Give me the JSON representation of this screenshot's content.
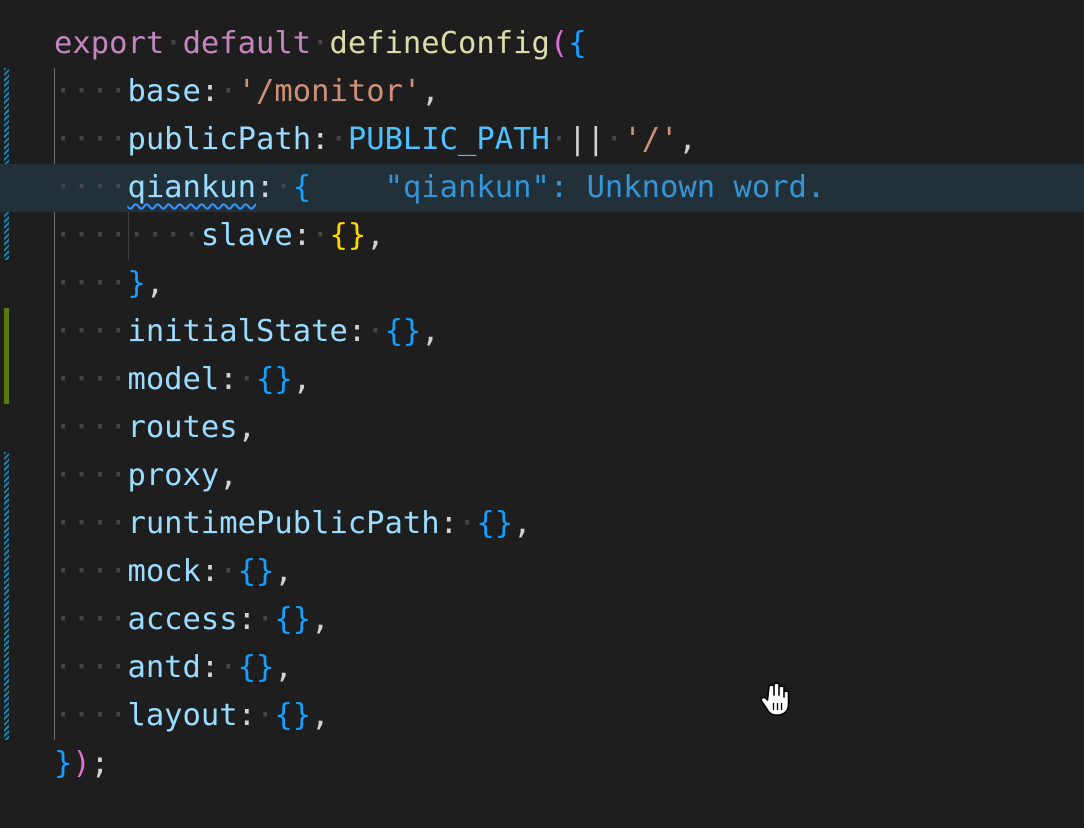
{
  "editor": {
    "lines": [
      {
        "tokens": [
          {
            "t": "export",
            "c": "kw"
          },
          {
            "t": "·",
            "c": "ws"
          },
          {
            "t": "default",
            "c": "kw"
          },
          {
            "t": "·",
            "c": "ws"
          },
          {
            "t": "defineConfig",
            "c": "fn"
          },
          {
            "t": "(",
            "c": "brace-pink"
          },
          {
            "t": "{",
            "c": "brace-blue"
          }
        ]
      },
      {
        "tokens": [
          {
            "t": "····",
            "c": "ws"
          },
          {
            "t": "base",
            "c": "prop"
          },
          {
            "t": ":",
            "c": "punct"
          },
          {
            "t": "·",
            "c": "ws"
          },
          {
            "t": "'/monitor'",
            "c": "str"
          },
          {
            "t": ",",
            "c": "punct"
          }
        ]
      },
      {
        "tokens": [
          {
            "t": "····",
            "c": "ws"
          },
          {
            "t": "publicPath",
            "c": "prop"
          },
          {
            "t": ":",
            "c": "punct"
          },
          {
            "t": "·",
            "c": "ws"
          },
          {
            "t": "PUBLIC_PATH",
            "c": "const"
          },
          {
            "t": "·",
            "c": "ws"
          },
          {
            "t": "||",
            "c": "punct"
          },
          {
            "t": "·",
            "c": "ws"
          },
          {
            "t": "'/'",
            "c": "str"
          },
          {
            "t": ",",
            "c": "punct"
          }
        ]
      },
      {
        "active": true,
        "tokens": [
          {
            "t": "····",
            "c": "ws"
          },
          {
            "t": "qiankun",
            "c": "prop squiggle"
          },
          {
            "t": ":",
            "c": "punct"
          },
          {
            "t": "·",
            "c": "ws"
          },
          {
            "t": "{",
            "c": "brace-blue"
          },
          {
            "t": "    ",
            "c": "punct"
          },
          {
            "t": "\"qiankun\": Unknown word.",
            "c": "hint"
          }
        ]
      },
      {
        "tokens": [
          {
            "t": "········",
            "c": "ws"
          },
          {
            "t": "slave",
            "c": "prop"
          },
          {
            "t": ":",
            "c": "punct"
          },
          {
            "t": "·",
            "c": "ws"
          },
          {
            "t": "{}",
            "c": "brace-yellow"
          },
          {
            "t": ",",
            "c": "punct"
          }
        ]
      },
      {
        "tokens": [
          {
            "t": "····",
            "c": "ws"
          },
          {
            "t": "}",
            "c": "brace-blue"
          },
          {
            "t": ",",
            "c": "punct"
          }
        ]
      },
      {
        "tokens": [
          {
            "t": "····",
            "c": "ws"
          },
          {
            "t": "initialState",
            "c": "prop"
          },
          {
            "t": ":",
            "c": "punct"
          },
          {
            "t": "·",
            "c": "ws"
          },
          {
            "t": "{}",
            "c": "brace-blue"
          },
          {
            "t": ",",
            "c": "punct"
          }
        ]
      },
      {
        "tokens": [
          {
            "t": "····",
            "c": "ws"
          },
          {
            "t": "model",
            "c": "prop"
          },
          {
            "t": ":",
            "c": "punct"
          },
          {
            "t": "·",
            "c": "ws"
          },
          {
            "t": "{}",
            "c": "brace-blue"
          },
          {
            "t": ",",
            "c": "punct"
          }
        ]
      },
      {
        "tokens": [
          {
            "t": "····",
            "c": "ws"
          },
          {
            "t": "routes",
            "c": "prop"
          },
          {
            "t": ",",
            "c": "punct"
          }
        ]
      },
      {
        "tokens": [
          {
            "t": "····",
            "c": "ws"
          },
          {
            "t": "proxy",
            "c": "prop"
          },
          {
            "t": ",",
            "c": "punct"
          }
        ]
      },
      {
        "tokens": [
          {
            "t": "····",
            "c": "ws"
          },
          {
            "t": "runtimePublicPath",
            "c": "prop"
          },
          {
            "t": ":",
            "c": "punct"
          },
          {
            "t": "·",
            "c": "ws"
          },
          {
            "t": "{}",
            "c": "brace-blue"
          },
          {
            "t": ",",
            "c": "punct"
          }
        ]
      },
      {
        "tokens": [
          {
            "t": "····",
            "c": "ws"
          },
          {
            "t": "mock",
            "c": "prop"
          },
          {
            "t": ":",
            "c": "punct"
          },
          {
            "t": "·",
            "c": "ws"
          },
          {
            "t": "{}",
            "c": "brace-blue"
          },
          {
            "t": ",",
            "c": "punct"
          }
        ]
      },
      {
        "tokens": [
          {
            "t": "····",
            "c": "ws"
          },
          {
            "t": "access",
            "c": "prop"
          },
          {
            "t": ":",
            "c": "punct"
          },
          {
            "t": "·",
            "c": "ws"
          },
          {
            "t": "{}",
            "c": "brace-blue"
          },
          {
            "t": ",",
            "c": "punct"
          }
        ]
      },
      {
        "tokens": [
          {
            "t": "····",
            "c": "ws"
          },
          {
            "t": "antd",
            "c": "prop"
          },
          {
            "t": ":",
            "c": "punct"
          },
          {
            "t": "·",
            "c": "ws"
          },
          {
            "t": "{}",
            "c": "brace-blue"
          },
          {
            "t": ",",
            "c": "punct"
          }
        ]
      },
      {
        "tokens": [
          {
            "t": "····",
            "c": "ws"
          },
          {
            "t": "layout",
            "c": "prop"
          },
          {
            "t": ":",
            "c": "punct"
          },
          {
            "t": "·",
            "c": "ws"
          },
          {
            "t": "{}",
            "c": "brace-blue"
          },
          {
            "t": ",",
            "c": "punct"
          }
        ]
      },
      {
        "tokens": [
          {
            "t": "}",
            "c": "brace-blue"
          },
          {
            "t": ")",
            "c": "brace-pink"
          },
          {
            "t": ";",
            "c": "punct"
          }
        ]
      }
    ],
    "hint_message": "\"qiankun\": Unknown word.",
    "cursor_icon": "hand-pointer-icon",
    "colors": {
      "background": "#1e1e1e",
      "active_line": "#213039",
      "gutter_modified": "#1b81a8",
      "gutter_added": "#587c0c"
    }
  }
}
